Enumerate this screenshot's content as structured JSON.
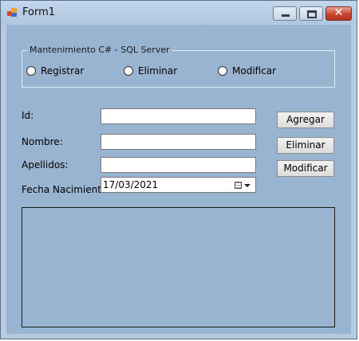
{
  "window": {
    "title": "Form1",
    "close_symbol": "✕"
  },
  "groupbox": {
    "title": "Mantenimiento C# - SQL Server",
    "options": [
      {
        "label": "Registrar",
        "icon": "radio-unchecked-icon"
      },
      {
        "label": "Eliminar",
        "icon": "radio-unchecked-icon"
      },
      {
        "label": "Modificar",
        "icon": "radio-unchecked-icon"
      }
    ]
  },
  "form": {
    "id_label": "Id:",
    "id_value": "",
    "nombre_label": "Nombre:",
    "nombre_value": "",
    "apellidos_label": "Apellidos:",
    "apellidos_value": "",
    "fecha_label": "Fecha Nacimiento:",
    "fecha_value": "17/03/2021"
  },
  "buttons": {
    "agregar": "Agregar",
    "eliminar": "Eliminar",
    "modificar": "Modificar"
  },
  "colors": {
    "form_background": "#99b4d1",
    "title_bar": "#b9cfe7",
    "close_button": "#c6452f"
  }
}
